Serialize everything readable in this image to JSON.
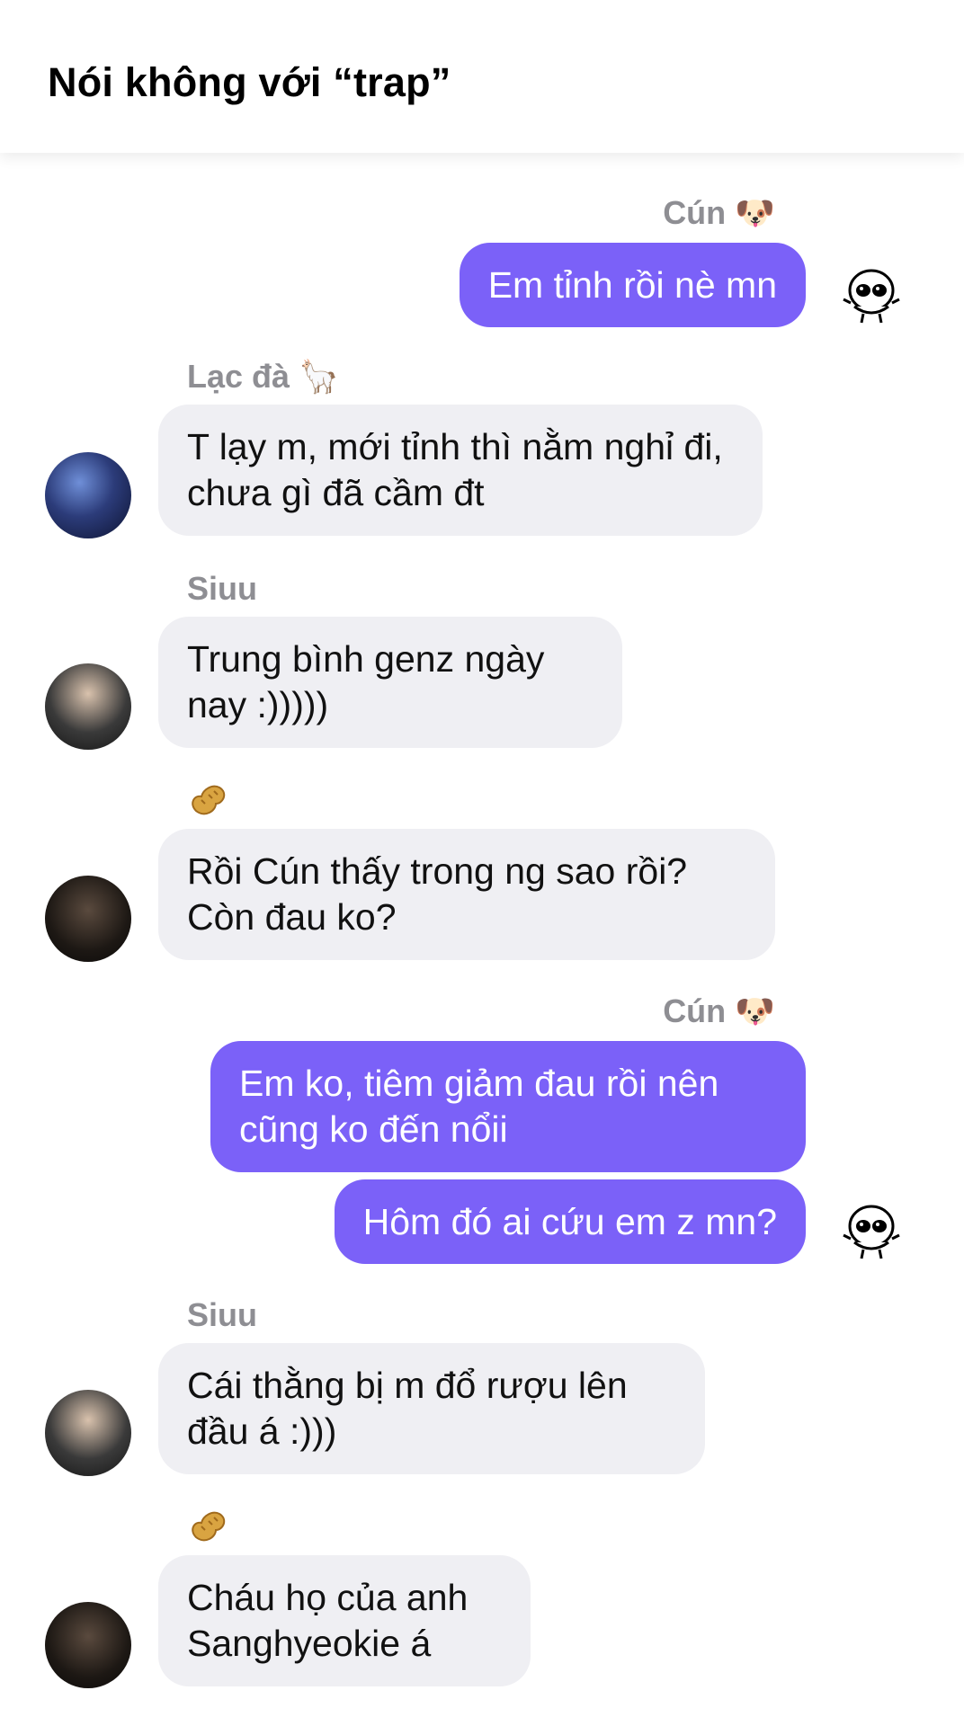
{
  "header": {
    "title": "Nói không với “trap”"
  },
  "messages": [
    {
      "sender": "Cún",
      "sender_emoji": "🐶",
      "text": "Em tỉnh rồi nè mn"
    },
    {
      "sender": "Lạc đà",
      "sender_emoji": "🦙",
      "text": "T lạy m, mới tỉnh thì nằm nghỉ đi, chưa gì đã cầm đt"
    },
    {
      "sender": "Siuu",
      "text": "Trung bình genz ngày nay :)))))"
    },
    {
      "sender_emoji": "🥜",
      "text": "Rồi Cún thấy trong ng sao rồi? Còn đau ko?"
    },
    {
      "sender": "Cún",
      "sender_emoji": "🐶",
      "text": "Em ko, tiêm giảm đau rồi nên cũng ko đến nổii"
    },
    {
      "text": "Hôm đó ai cứu em z mn?"
    },
    {
      "sender": "Siuu",
      "text": "Cái thằng bị m đổ rượu lên đầu á :)))"
    },
    {
      "sender_emoji": "🥜",
      "text": "Cháu họ của anh Sanghyeokie á"
    }
  ],
  "colors": {
    "outgoing_bubble": "#7b61f8",
    "incoming_bubble": "#efeff3",
    "sender_name": "#8e8e93"
  },
  "icons": {
    "self_avatar": "cartoon-ghost-sticker-icon",
    "peanut": "peanut-emoji-icon"
  }
}
